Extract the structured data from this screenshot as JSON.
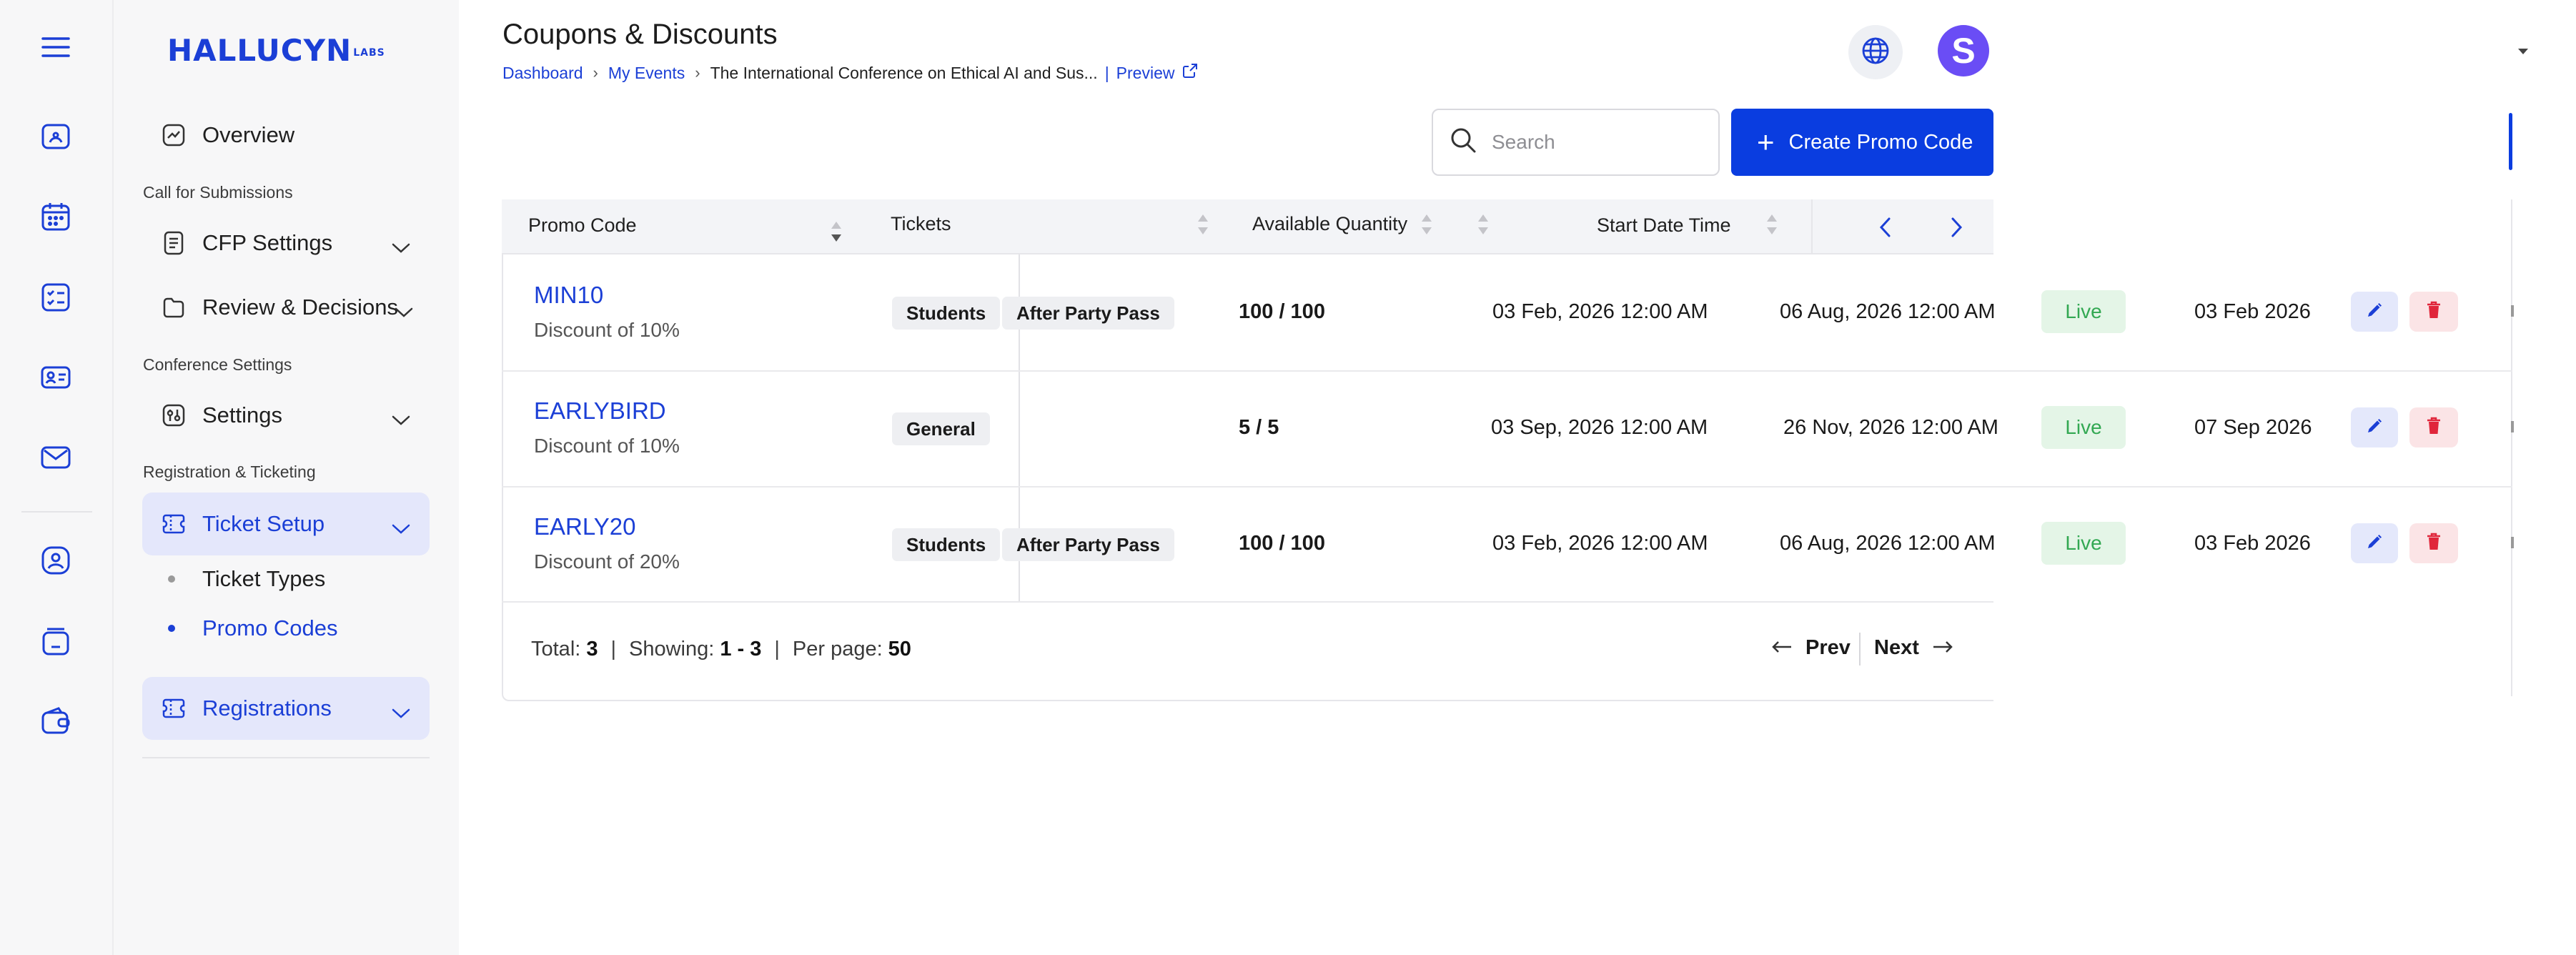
{
  "app": {
    "logo_text": "HALLUCYN",
    "logo_suffix": "LABS"
  },
  "rail_icons": [
    "menu-icon",
    "home-icon",
    "calendar-icon",
    "checklist-icon",
    "contact-card-icon",
    "mail-icon",
    "user-circle-icon",
    "storage-icon",
    "wallet-icon"
  ],
  "sidebar": {
    "overview": "Overview",
    "section_cfp": "Call for Submissions",
    "cfp_settings": "CFP Settings",
    "review": "Review & Decisions",
    "section_conf": "Conference Settings",
    "settings": "Settings",
    "section_reg": "Registration & Ticketing",
    "ticket_setup": "Ticket Setup",
    "ticket_types": "Ticket Types",
    "promo_codes": "Promo Codes",
    "registrations": "Registrations"
  },
  "header": {
    "title": "Coupons & Discounts",
    "crumb_dashboard": "Dashboard",
    "crumb_events": "My Events",
    "crumb_event": "The International Conference on Ethical AI and Sus...",
    "crumb_sep": "|",
    "crumb_preview": "Preview",
    "avatar_letter": "S"
  },
  "toolbar": {
    "search_placeholder": "Search",
    "create_label": "Create Promo Code"
  },
  "table": {
    "columns": {
      "promo_code": "Promo Code",
      "tickets": "Tickets",
      "available_quantity": "Available Quantity",
      "start_date_time": "Start Date Time"
    },
    "rows": [
      {
        "code": "MIN10",
        "desc": "Discount of 10%",
        "tickets": [
          "Students",
          "After Party Pass"
        ],
        "qty": "100 / 100",
        "start": "03 Feb, 2026 12:00 AM",
        "end": "06 Aug, 2026 12:00 AM",
        "status": "Live",
        "created": "03 Feb 2026"
      },
      {
        "code": "EARLYBIRD",
        "desc": "Discount of 10%",
        "tickets": [
          "General"
        ],
        "qty": "5 / 5",
        "start": "03 Sep, 2026 12:00 AM",
        "end": "26 Nov, 2026 12:00 AM",
        "status": "Live",
        "created": "07 Sep 2026"
      },
      {
        "code": "EARLY20",
        "desc": "Discount of 20%",
        "tickets": [
          "Students",
          "After Party Pass"
        ],
        "qty": "100 / 100",
        "start": "03 Feb, 2026 12:00 AM",
        "end": "06 Aug, 2026 12:00 AM",
        "status": "Live",
        "created": "03 Feb 2026"
      }
    ]
  },
  "footer": {
    "total_label": "Total:",
    "total": "3",
    "showing_label": "Showing:",
    "showing": "1 - 3",
    "per_page_label": "Per page:",
    "per_page": "50",
    "sep": "|",
    "prev": "Prev",
    "next": "Next"
  },
  "colors": {
    "brand": "#1b3fd6",
    "primary_button": "#0a3de0",
    "live": "#32a852",
    "delete": "#e0263b",
    "avatar": "#6a4df5"
  }
}
